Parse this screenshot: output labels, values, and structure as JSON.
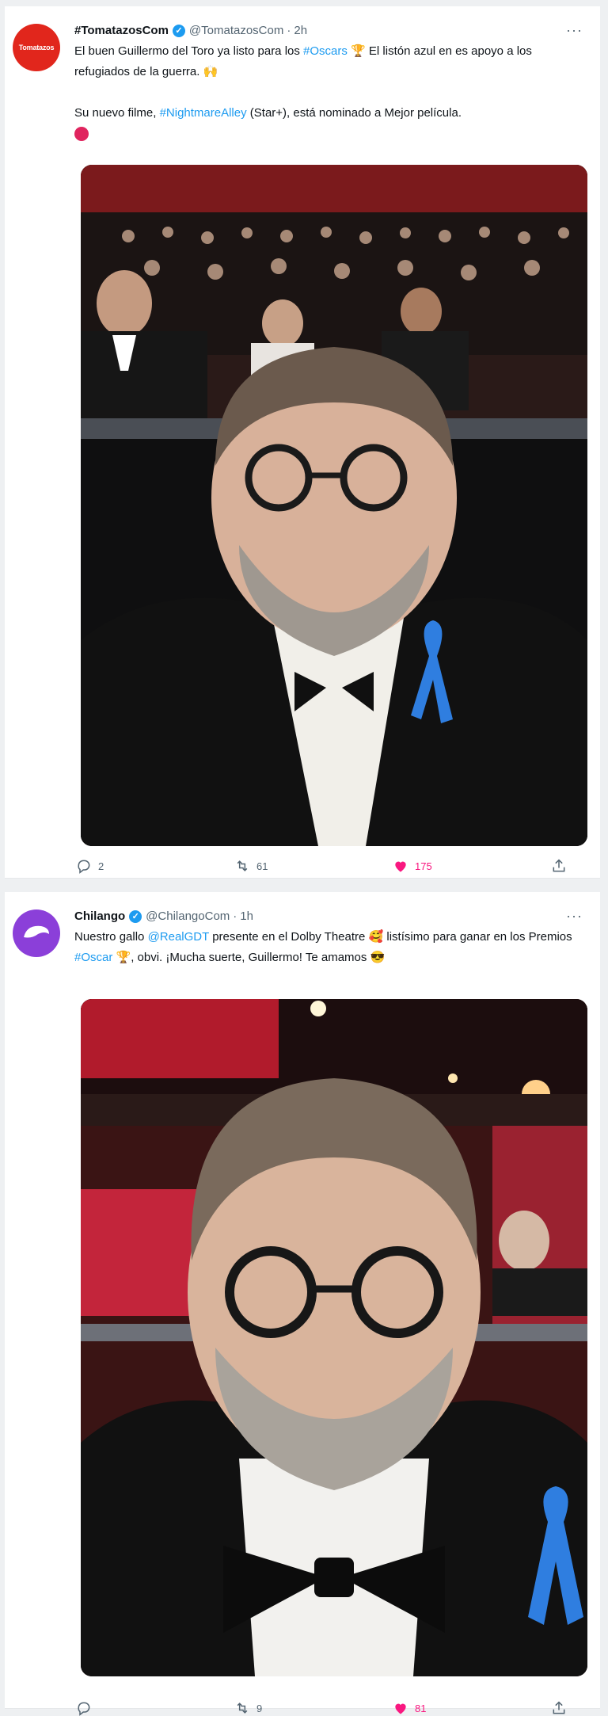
{
  "tweets": [
    {
      "avatar_text": "Tomatazos",
      "avatar_color": "#e1261c",
      "name": "#TomatazosCom",
      "handle": "@TomatazosCom",
      "time": "2h",
      "line1_pre": "El buen Guillermo del Toro ya listo para los ",
      "line1_tag": "#Oscars",
      "line1_post": " 🏆 El listón azul en es apoyo a los refugiados de la guerra. 🙌",
      "line2_pre": "Su nuevo filme, ",
      "line2_tag": "#NightmareAlley",
      "line2_post": " (Star+), está nominado a Mejor película.",
      "replies": "2",
      "retweets": "61",
      "likes": "175"
    },
    {
      "avatar_color": "#8b3fd9",
      "name": "Chilango",
      "handle": "@ChilangoCom",
      "time": "1h",
      "line1_pre": "Nuestro gallo ",
      "line1_mention": "@RealGDT",
      "line1_mid": " presente en el Dolby Theatre 🥰 listísimo para ganar en los Premios ",
      "line1_tag": "#Oscar",
      "line1_post": " 🏆, obvi. ¡Mucha suerte, Guillermo! Te amamos 😎",
      "replies": "",
      "retweets": "9",
      "likes": "81"
    }
  ]
}
